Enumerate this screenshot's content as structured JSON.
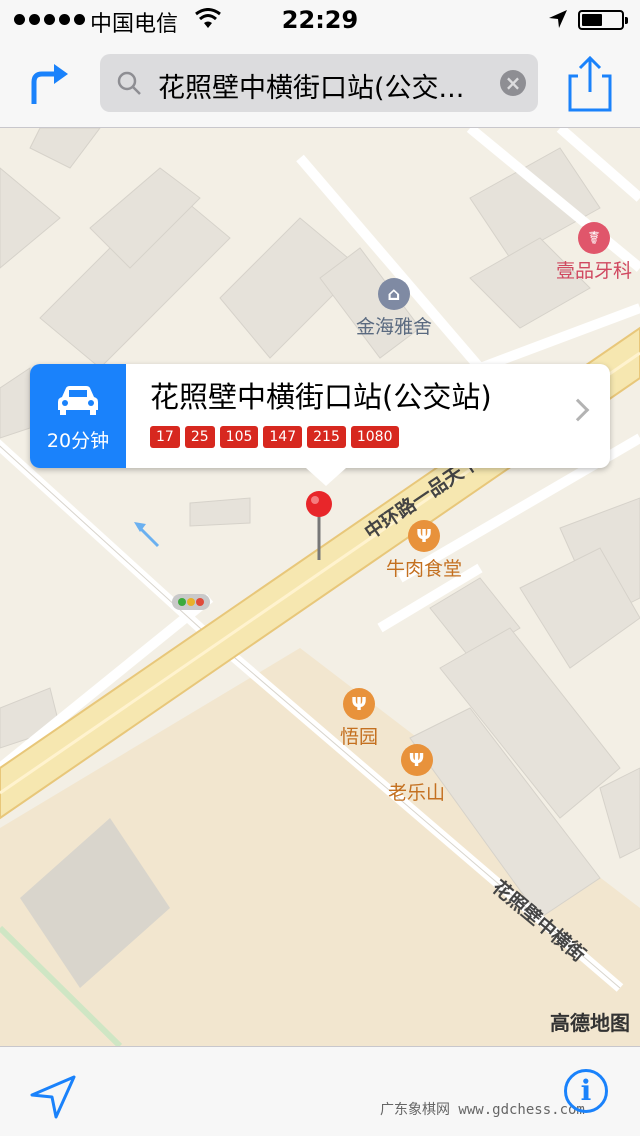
{
  "status_bar": {
    "carrier": "中国电信",
    "time": "22:29"
  },
  "search": {
    "query": "花照壁中横街口站(公交..."
  },
  "map": {
    "pois": [
      {
        "name": "金海雅舍",
        "icon": "building-icon",
        "color": "#7f8aa3"
      },
      {
        "name": "壹品牙科",
        "icon": "dental-icon",
        "color": "#e0566b"
      },
      {
        "name": "牛肉食堂",
        "icon": "restaurant-icon",
        "color": "#e8923b"
      },
      {
        "name": "悟园",
        "icon": "restaurant-icon",
        "color": "#e8923b"
      },
      {
        "name": "老乐山",
        "icon": "restaurant-icon",
        "color": "#e8923b"
      }
    ],
    "roads": [
      "中环路一品天下大",
      "花照壁中横街"
    ],
    "provider_logo": "高德地图"
  },
  "callout": {
    "drive_time": "20分钟",
    "stop_name": "花照壁中横街口站(公交站)",
    "routes": [
      "17",
      "25",
      "105",
      "147",
      "215",
      "1080"
    ]
  },
  "toolbar": {
    "watermark": "广东象棋网 www.gdchess.com"
  }
}
